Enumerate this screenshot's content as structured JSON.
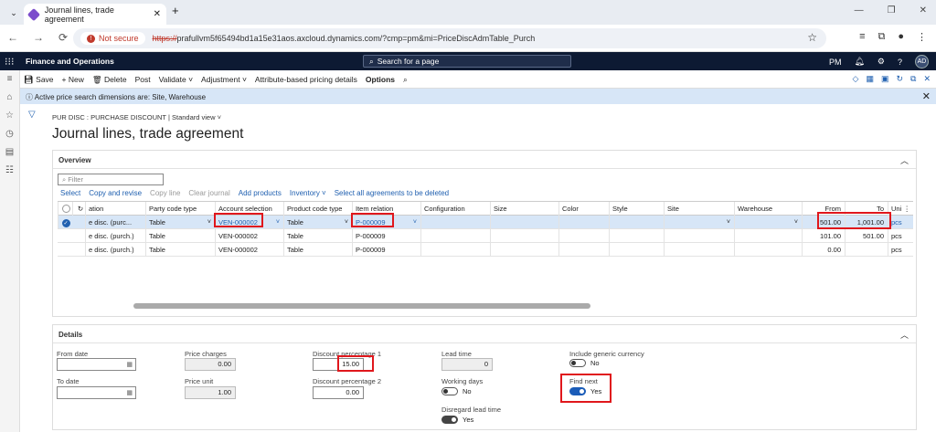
{
  "browser": {
    "tab_title": "Journal lines, trade agreement",
    "not_secure": "Not secure",
    "url_scheme": "https://",
    "url_rest": "prafullvm5f65494bd1a15e31aos.axcloud.dynamics.com/?cmp=pm&mi=PriceDiscAdmTable_Purch"
  },
  "appbar": {
    "brand": "Finance and Operations",
    "search": "Search for a page",
    "company": "PM",
    "avatar": "AD"
  },
  "actions": {
    "save": "Save",
    "new": "New",
    "delete": "Delete",
    "post": "Post",
    "validate": "Validate",
    "adjustment": "Adjustment",
    "attr_pricing": "Attribute-based pricing details",
    "options": "Options"
  },
  "message": "Active price search dimensions are: Site, Warehouse",
  "breadcrumb": "PUR DISC : PURCHASE DISCOUNT  |  Standard view",
  "page_title": "Journal lines, trade agreement",
  "overview": {
    "title": "Overview",
    "filter_placeholder": "Filter",
    "grid_actions": [
      "Select",
      "Copy and revise",
      "Copy line",
      "Clear journal",
      "Add products",
      "Inventory",
      "Select all agreements to be deleted"
    ],
    "columns": [
      "ation",
      "Party code type",
      "Account selection",
      "Product code type",
      "Item relation",
      "Configuration",
      "Size",
      "Color",
      "Style",
      "Site",
      "Warehouse",
      "From",
      "To",
      "Uni"
    ],
    "rows": [
      [
        "e disc. (purc...",
        "Table",
        "VEN-000002",
        "Table",
        "P-000009",
        "",
        "",
        "",
        "",
        "",
        "",
        "501.00",
        "1,001.00",
        "pcs"
      ],
      [
        "e disc. (purch.)",
        "Table",
        "VEN-000002",
        "Table",
        "P-000009",
        "",
        "",
        "",
        "",
        "",
        "",
        "101.00",
        "501.00",
        "pcs"
      ],
      [
        "e disc. (purch.)",
        "Table",
        "VEN-000002",
        "Table",
        "P-000009",
        "",
        "",
        "",
        "",
        "",
        "",
        "0.00",
        "",
        "pcs"
      ]
    ]
  },
  "details": {
    "title": "Details",
    "from_date": "From date",
    "to_date": "To date",
    "price_charges": "Price charges",
    "price_charges_val": "0.00",
    "price_unit": "Price unit",
    "price_unit_val": "1.00",
    "disc_pct1": "Discount percentage 1",
    "disc_pct1_val": "15.00",
    "disc_pct2": "Discount percentage 2",
    "disc_pct2_val": "0.00",
    "lead_time": "Lead time",
    "lead_time_val": "0",
    "working_days": "Working days",
    "working_days_val": "No",
    "disregard_lead": "Disregard lead time",
    "disregard_lead_val": "Yes",
    "incl_generic": "Include generic currency",
    "incl_generic_val": "No",
    "find_next": "Find next",
    "find_next_val": "Yes"
  },
  "highlight_color": "#e0171c",
  "accent_color": "#2060b0"
}
